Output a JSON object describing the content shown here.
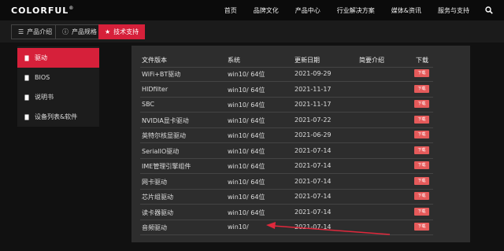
{
  "header": {
    "logo": "COLORFUL",
    "logo_mark": "®",
    "nav": [
      "首页",
      "品牌文化",
      "产品中心",
      "行业解决方案",
      "媒体&资讯",
      "服务与支持"
    ]
  },
  "tabs": [
    {
      "label": "产品介绍"
    },
    {
      "label": "产品规格"
    },
    {
      "label": "技术支持"
    }
  ],
  "sidebar": {
    "items": [
      {
        "label": "驱动"
      },
      {
        "label": "BIOS"
      },
      {
        "label": "说明书"
      },
      {
        "label": "设备列表&软件"
      }
    ]
  },
  "table": {
    "headers": [
      "文件版本",
      "系统",
      "更新日期",
      "简要介绍",
      "下载"
    ],
    "download_label": "下载",
    "rows": [
      {
        "name": "WiFi+BT驱动",
        "os": "win10/ 64位",
        "date": "2021-09-29",
        "desc": ""
      },
      {
        "name": "HIDfilter",
        "os": "win10/ 64位",
        "date": "2021-11-17",
        "desc": ""
      },
      {
        "name": "SBC",
        "os": "win10/ 64位",
        "date": "2021-11-17",
        "desc": ""
      },
      {
        "name": "NVIDIA显卡驱动",
        "os": "win10/ 64位",
        "date": "2021-07-22",
        "desc": ""
      },
      {
        "name": "英特尔核显驱动",
        "os": "win10/ 64位",
        "date": "2021-06-29",
        "desc": ""
      },
      {
        "name": "SerialIO驱动",
        "os": "win10/ 64位",
        "date": "2021-07-14",
        "desc": ""
      },
      {
        "name": "IME管理引擎组件",
        "os": "win10/ 64位",
        "date": "2021-07-14",
        "desc": ""
      },
      {
        "name": "网卡驱动",
        "os": "win10/ 64位",
        "date": "2021-07-14",
        "desc": ""
      },
      {
        "name": "芯片组驱动",
        "os": "win10/ 64位",
        "date": "2021-07-14",
        "desc": ""
      },
      {
        "name": "读卡器驱动",
        "os": "win10/ 64位",
        "date": "2021-07-14",
        "desc": ""
      },
      {
        "name": "音频驱动",
        "os": "win10/",
        "date": "2021-07-14",
        "desc": ""
      }
    ]
  },
  "colors": {
    "accent": "#d6203a",
    "download": "#e55a5a",
    "arrow": "#e0283c"
  }
}
